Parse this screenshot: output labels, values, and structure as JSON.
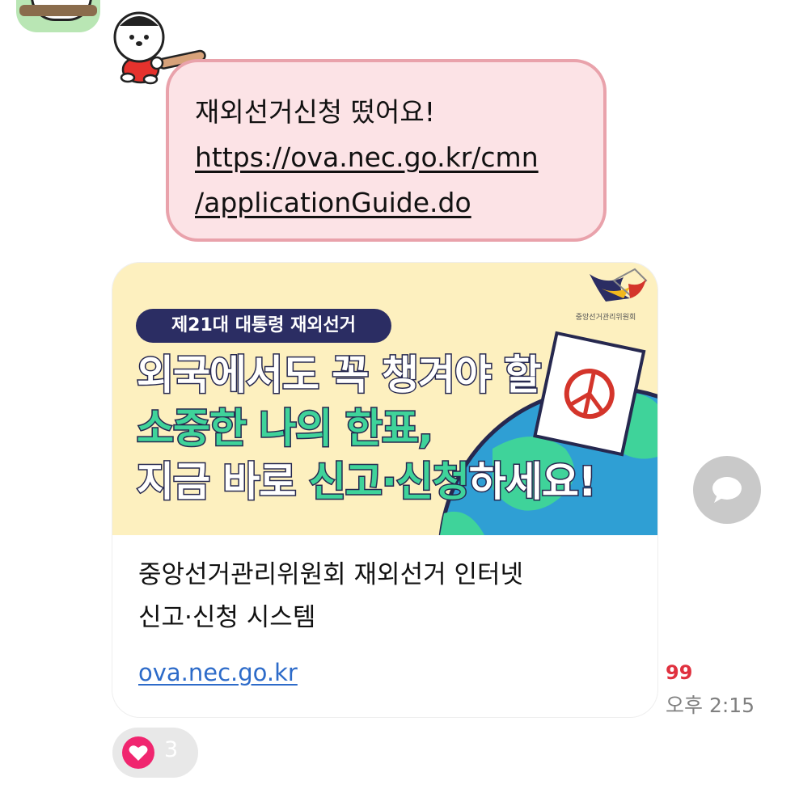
{
  "message": {
    "lines": [
      "재외선거신청 떴어요!",
      "https://ova.nec.go.kr/cmn",
      "/applicationGuide.do"
    ]
  },
  "link_card": {
    "banner": {
      "badge": "제21대 대통령 재외선거",
      "org_logo_text": "중앙선거관리위원회",
      "headline_1": "외국에서도 꼭 챙겨야 할",
      "headline_2": "소중한 나의 한표,",
      "headline_3a": "지금 바로 ",
      "headline_3b": "신고·신청",
      "headline_3c": "하세요!"
    },
    "title_lines": [
      "중앙선거관리위원회 재외선거 인터넷",
      "신고·신청 시스템"
    ],
    "domain": "ova.nec.go.kr"
  },
  "meta": {
    "unread_count": "99",
    "time": "오후 2:15"
  },
  "reaction": {
    "icon": "heart-icon",
    "count": "3"
  },
  "icons": {
    "comment": "speech-bubble-icon",
    "sticker": "bear-baseball-sticker"
  },
  "colors": {
    "bubble_bg": "#fce3e6",
    "bubble_border": "#e9a2ab",
    "banner_bg": "#fdf0bf",
    "link": "#2d6bc9",
    "unread": "#e0313f",
    "heart": "#f0266f"
  }
}
